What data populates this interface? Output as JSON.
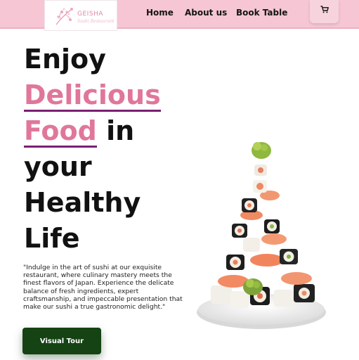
{
  "header": {
    "logo": {
      "name": "GEISHA",
      "subtitle": "Sushi Restaurant",
      "icon": "cherry-blossom-icon"
    },
    "nav": [
      {
        "label": "Home"
      },
      {
        "label": "About us"
      },
      {
        "label": "Book Table"
      }
    ],
    "cart_icon": "shopping-cart-icon"
  },
  "hero": {
    "word1": "Enjoy",
    "word2": "Delicious",
    "word3": "Food",
    "word4": "in",
    "word5": "your",
    "word6": "Healthy",
    "word7": "Life"
  },
  "description": "\"Indulge in the art of sushi at our exquisite restaurant, where culinary mastery meets the finest flavors of Japan. Experience the delicate balance of fresh ingredients, expert craftsmanship, and impeccable presentation that make our sushi a true gastronomic delight.\"",
  "cta": {
    "label": "Visual Tour"
  },
  "colors": {
    "header_bg": "#f6c6d4",
    "accent_pink": "#e0779a",
    "underline_purple": "#7b1f72",
    "button_green": "#154314"
  }
}
